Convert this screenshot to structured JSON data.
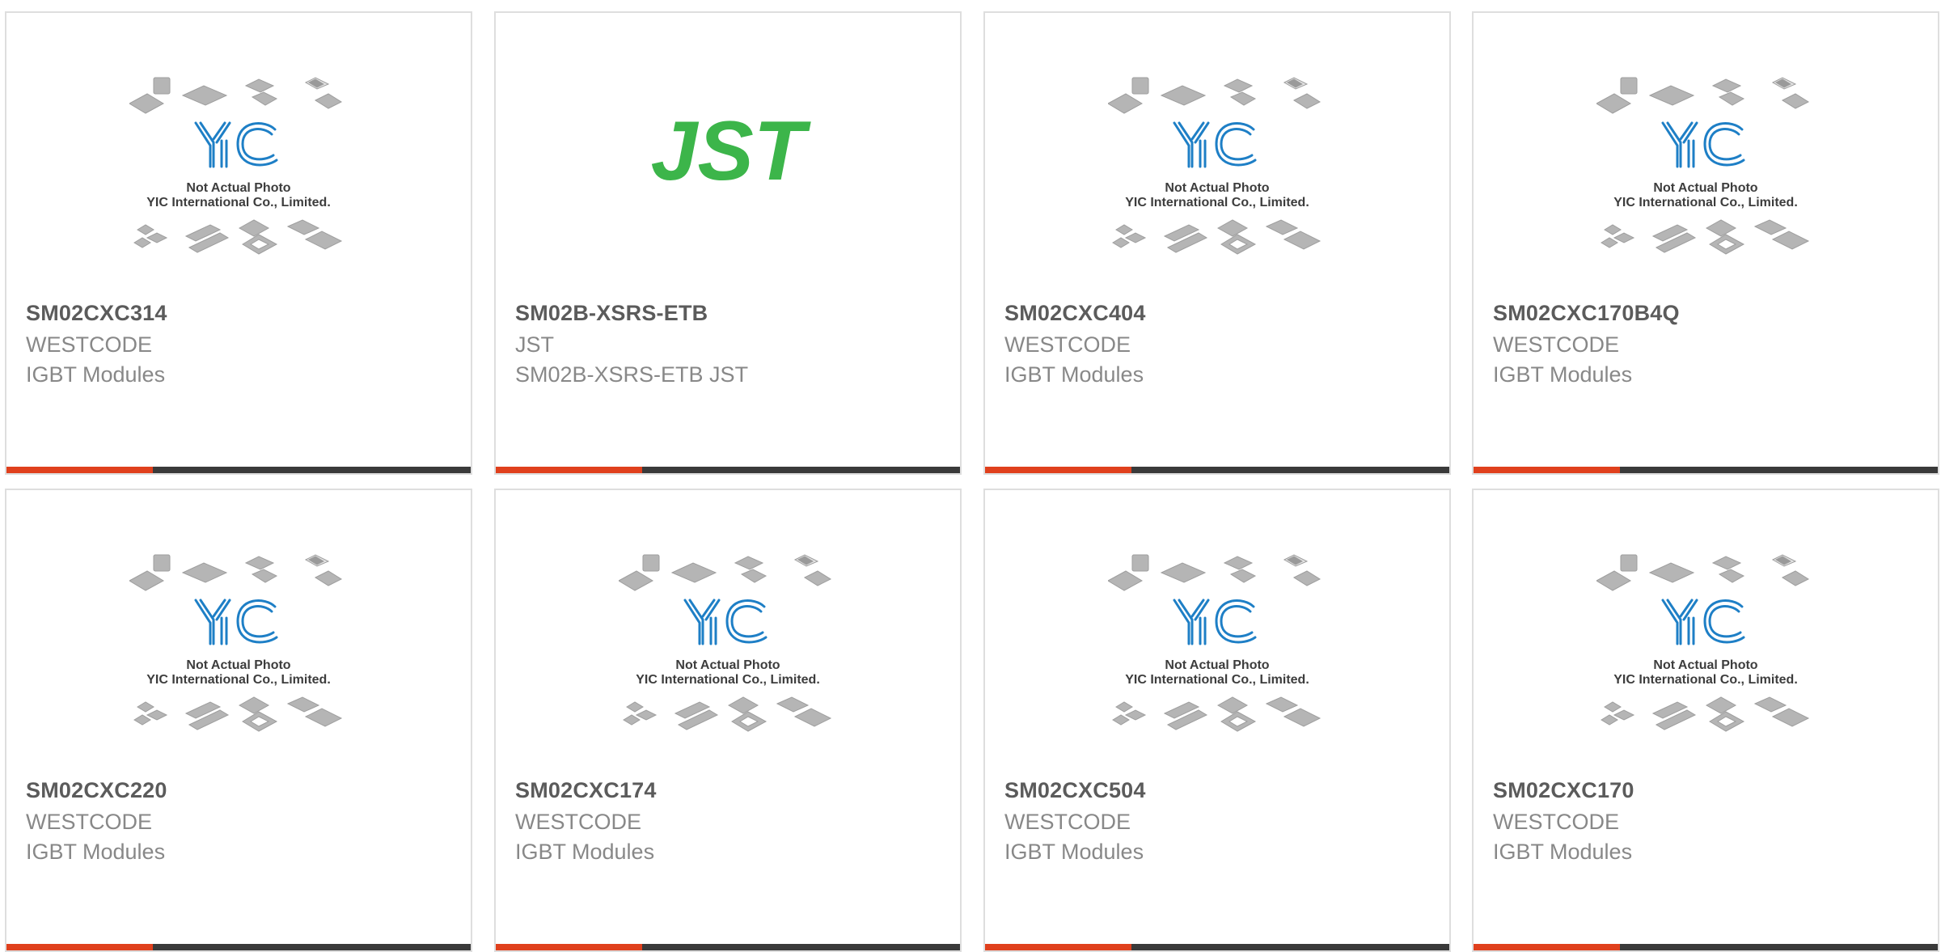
{
  "colors": {
    "accent_bar": "#e0401d",
    "dark_bar": "#3a3a3a",
    "yic_logo": "#1e7fc6",
    "jst_logo": "#3cb54a",
    "part_text": "#5b5b5b",
    "meta_text": "#888888"
  },
  "placeholder": {
    "line1": "Not Actual Photo",
    "line2": "YIC International Co., Limited."
  },
  "products": [
    {
      "part": "SM02CXC314",
      "brand": "WESTCODE",
      "desc": "IGBT Modules",
      "image": "yic-placeholder"
    },
    {
      "part": "SM02B-XSRS-ETB",
      "brand": "JST",
      "desc": "SM02B-XSRS-ETB JST",
      "image": "jst-logo",
      "logo_text": "JST"
    },
    {
      "part": "SM02CXC404",
      "brand": "WESTCODE",
      "desc": "IGBT Modules",
      "image": "yic-placeholder"
    },
    {
      "part": "SM02CXC170B4Q",
      "brand": "WESTCODE",
      "desc": "IGBT Modules",
      "image": "yic-placeholder"
    },
    {
      "part": "SM02CXC220",
      "brand": "WESTCODE",
      "desc": "IGBT Modules",
      "image": "yic-placeholder"
    },
    {
      "part": "SM02CXC174",
      "brand": "WESTCODE",
      "desc": "IGBT Modules",
      "image": "yic-placeholder"
    },
    {
      "part": "SM02CXC504",
      "brand": "WESTCODE",
      "desc": "IGBT Modules",
      "image": "yic-placeholder"
    },
    {
      "part": "SM02CXC170",
      "brand": "WESTCODE",
      "desc": "IGBT Modules",
      "image": "yic-placeholder"
    }
  ]
}
